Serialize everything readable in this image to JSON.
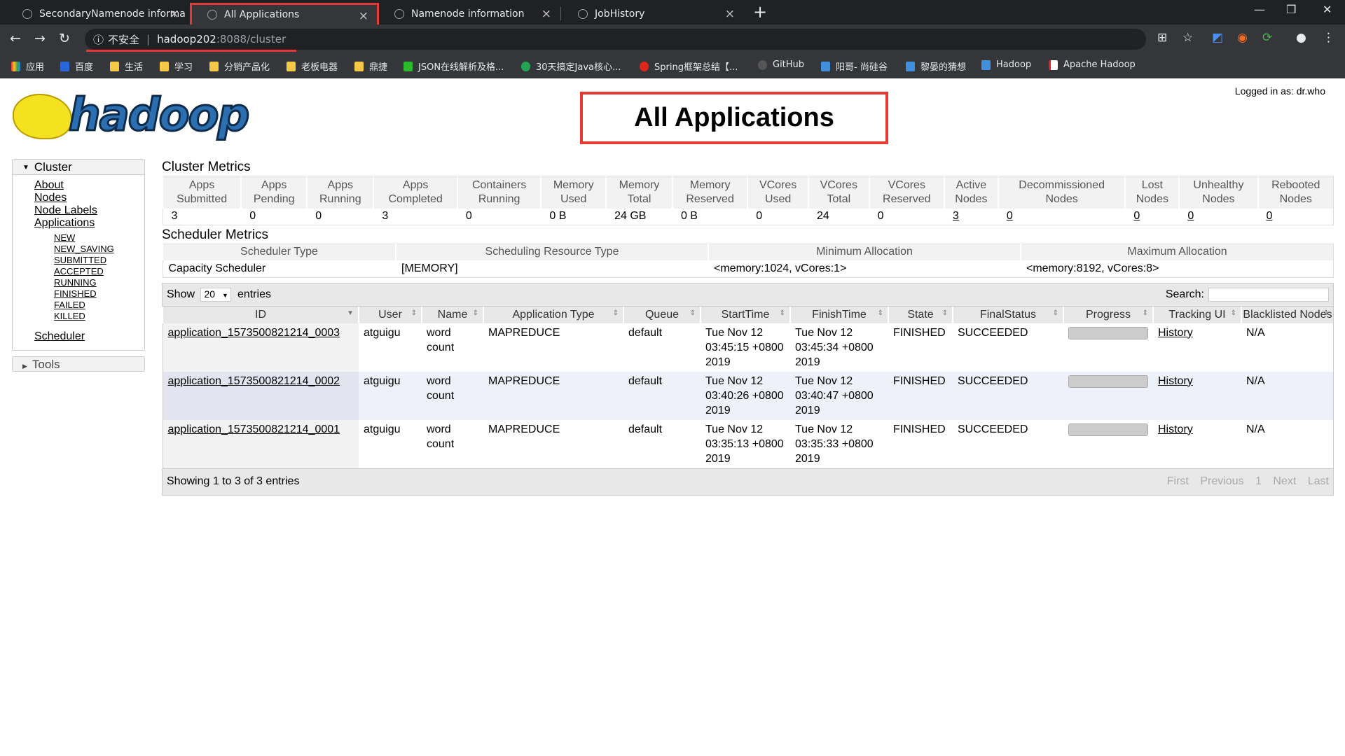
{
  "browser": {
    "tabs": [
      {
        "title": "SecondaryNamenode informa",
        "active": false
      },
      {
        "title": "All Applications",
        "active": true
      },
      {
        "title": "Namenode information",
        "active": false
      },
      {
        "title": "JobHistory",
        "active": false
      }
    ],
    "new_tab": "+",
    "insecure_label": "不安全",
    "url_host": "hadoop202",
    "url_rest": ":8088/cluster",
    "bookmarks": [
      "应用",
      "百度",
      "生活",
      "学习",
      "分销产品化",
      "老板电器",
      "鼎捷",
      "JSON在线解析及格...",
      "30天搞定Java核心...",
      "Spring框架总结【...",
      "GitHub",
      "阳哥- 尚硅谷",
      "黎晏的猜想",
      "Hadoop",
      "Apache Hadoop"
    ]
  },
  "page": {
    "logo_text": "hadoop",
    "logged_in": "Logged in as: dr.who",
    "title": "All Applications"
  },
  "nav": {
    "cluster_label": "Cluster",
    "links": [
      "About",
      "Nodes",
      "Node Labels",
      "Applications"
    ],
    "states": [
      "NEW",
      "NEW_SAVING",
      "SUBMITTED",
      "ACCEPTED",
      "RUNNING",
      "FINISHED",
      "FAILED",
      "KILLED"
    ],
    "scheduler": "Scheduler",
    "tools_label": "Tools"
  },
  "cluster_metrics": {
    "title": "Cluster Metrics",
    "headers": [
      [
        "Apps",
        "Submitted"
      ],
      [
        "Apps",
        "Pending"
      ],
      [
        "Apps",
        "Running"
      ],
      [
        "Apps",
        "Completed"
      ],
      [
        "Containers",
        "Running"
      ],
      [
        "Memory",
        "Used"
      ],
      [
        "Memory",
        "Total"
      ],
      [
        "Memory",
        "Reserved"
      ],
      [
        "VCores",
        "Used"
      ],
      [
        "VCores",
        "Total"
      ],
      [
        "VCores",
        "Reserved"
      ],
      [
        "Active",
        "Nodes"
      ],
      [
        "Decommissioned",
        "Nodes"
      ],
      [
        "Lost",
        "Nodes"
      ],
      [
        "Unhealthy",
        "Nodes"
      ],
      [
        "Rebooted",
        "Nodes"
      ]
    ],
    "values": [
      "3",
      "0",
      "0",
      "3",
      "0",
      "0 B",
      "24 GB",
      "0 B",
      "0",
      "24",
      "0",
      "3",
      "0",
      "0",
      "0",
      "0"
    ],
    "linked": [
      false,
      false,
      false,
      false,
      false,
      false,
      false,
      false,
      false,
      false,
      false,
      true,
      true,
      true,
      true,
      true
    ]
  },
  "scheduler_metrics": {
    "title": "Scheduler Metrics",
    "headers": [
      "Scheduler Type",
      "Scheduling Resource Type",
      "Minimum Allocation",
      "Maximum Allocation"
    ],
    "values": [
      "Capacity Scheduler",
      "[MEMORY]",
      "<memory:1024, vCores:1>",
      "<memory:8192, vCores:8>"
    ]
  },
  "apps_table": {
    "show_label": "Show",
    "page_length": "20",
    "entries_label": "entries",
    "search_label": "Search:",
    "headers": [
      "ID",
      "User",
      "Name",
      "Application Type",
      "Queue",
      "StartTime",
      "FinishTime",
      "State",
      "FinalStatus",
      "Progress",
      "Tracking UI",
      "Blacklisted Nodes"
    ],
    "rows": [
      {
        "id": "application_1573500821214_0003",
        "user": "atguigu",
        "name": "word count",
        "type": "MAPREDUCE",
        "queue": "default",
        "start": "Tue Nov 12 03:45:15 +0800 2019",
        "finish": "Tue Nov 12 03:45:34 +0800 2019",
        "state": "FINISHED",
        "final": "SUCCEEDED",
        "progress": 1.0,
        "tracking": "History",
        "blacklisted": "N/A"
      },
      {
        "id": "application_1573500821214_0002",
        "user": "atguigu",
        "name": "word count",
        "type": "MAPREDUCE",
        "queue": "default",
        "start": "Tue Nov 12 03:40:26 +0800 2019",
        "finish": "Tue Nov 12 03:40:47 +0800 2019",
        "state": "FINISHED",
        "final": "SUCCEEDED",
        "progress": 1.0,
        "tracking": "History",
        "blacklisted": "N/A"
      },
      {
        "id": "application_1573500821214_0001",
        "user": "atguigu",
        "name": "word count",
        "type": "MAPREDUCE",
        "queue": "default",
        "start": "Tue Nov 12 03:35:13 +0800 2019",
        "finish": "Tue Nov 12 03:35:33 +0800 2019",
        "state": "FINISHED",
        "final": "SUCCEEDED",
        "progress": 1.0,
        "tracking": "History",
        "blacklisted": "N/A"
      }
    ],
    "info": "Showing 1 to 3 of 3 entries",
    "pager": [
      "First",
      "Previous",
      "1",
      "Next",
      "Last"
    ]
  }
}
